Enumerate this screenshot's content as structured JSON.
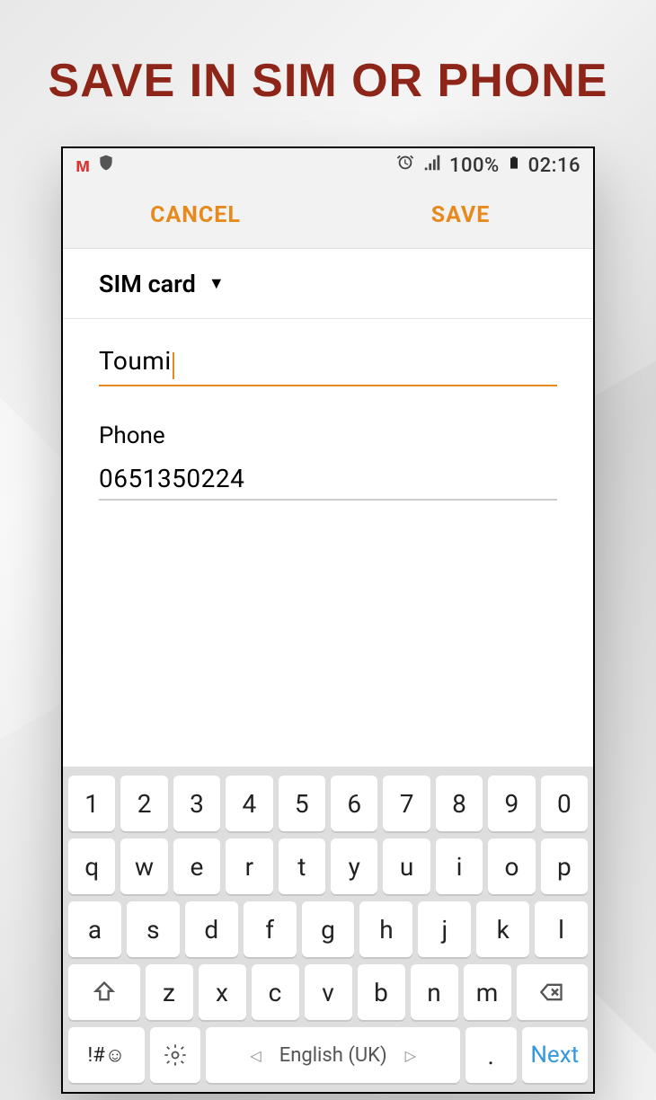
{
  "title": "Save in SIM or Phone",
  "statusbar": {
    "battery_pct": "100%",
    "time": "02:16"
  },
  "actions": {
    "cancel": "CANCEL",
    "save": "SAVE"
  },
  "storage": {
    "selected": "SIM card"
  },
  "form": {
    "name_value": "Toumi",
    "phone_label": "Phone",
    "phone_value": "0651350224"
  },
  "keyboard": {
    "rows": [
      [
        "1",
        "2",
        "3",
        "4",
        "5",
        "6",
        "7",
        "8",
        "9",
        "0"
      ],
      [
        "q",
        "w",
        "e",
        "r",
        "t",
        "y",
        "u",
        "i",
        "o",
        "p"
      ],
      [
        "a",
        "s",
        "d",
        "f",
        "g",
        "h",
        "j",
        "k",
        "l"
      ],
      [
        "z",
        "x",
        "c",
        "v",
        "b",
        "n",
        "m"
      ]
    ],
    "symbols_key": "!#☺",
    "language": "English (UK)",
    "period_key": ".",
    "next": "Next"
  }
}
